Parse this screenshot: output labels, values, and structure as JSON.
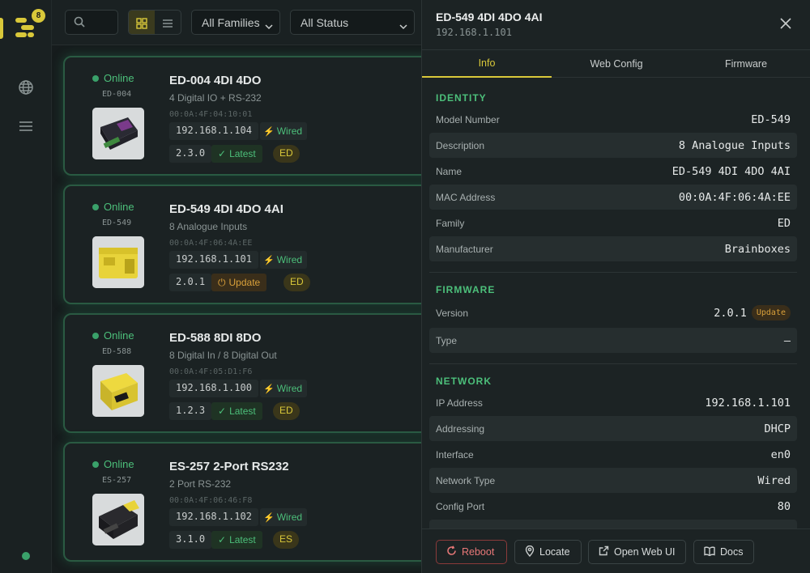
{
  "rail": {
    "badge": "8"
  },
  "toolbar": {
    "search_placeholder": "",
    "family_filter": "All Families",
    "status_filter": "All Status"
  },
  "devices": [
    {
      "status": "Online",
      "model": "ED-004",
      "title": "ED-004 4DI 4DO",
      "desc": "4 Digital IO + RS-232",
      "mac": "00:0A:4F:04:10:01",
      "ip": "192.168.1.104",
      "net": "Wired",
      "version": "2.3.0",
      "fw": "Latest",
      "family": "ED"
    },
    {
      "status": "Online",
      "model": "ED-549",
      "title": "ED-549 4DI 4DO 4AI",
      "desc": "8 Analogue Inputs",
      "mac": "00:0A:4F:06:4A:EE",
      "ip": "192.168.1.101",
      "net": "Wired",
      "version": "2.0.1",
      "fw": "Update",
      "family": "ED"
    },
    {
      "status": "Online",
      "model": "ED-588",
      "title": "ED-588 8DI 8DO",
      "desc": "8 Digital In / 8 Digital Out",
      "mac": "00:0A:4F:05:D1:F6",
      "ip": "192.168.1.100",
      "net": "Wired",
      "version": "1.2.3",
      "fw": "Latest",
      "family": "ED"
    },
    {
      "status": "Online",
      "model": "ES-257",
      "title": "ES-257 2-Port RS232",
      "desc": "2 Port RS-232",
      "mac": "00:0A:4F:06:46:F8",
      "ip": "192.168.1.102",
      "net": "Wired",
      "version": "3.1.0",
      "fw": "Latest",
      "family": "ES"
    }
  ],
  "drawer": {
    "title": "ED-549 4DI 4DO 4AI",
    "subtitle": "192.168.1.101",
    "tabs": [
      "Info",
      "Web Config",
      "Firmware"
    ],
    "identity": {
      "heading": "IDENTITY",
      "rows": [
        {
          "k": "Model Number",
          "v": "ED-549"
        },
        {
          "k": "Description",
          "v": "8 Analogue Inputs"
        },
        {
          "k": "Name",
          "v": "ED-549 4DI 4DO 4AI"
        },
        {
          "k": "MAC Address",
          "v": "00:0A:4F:06:4A:EE"
        },
        {
          "k": "Family",
          "v": "ED"
        },
        {
          "k": "Manufacturer",
          "v": "Brainboxes"
        }
      ]
    },
    "firmware": {
      "heading": "FIRMWARE",
      "version_label": "Version",
      "version": "2.0.1",
      "update_badge": "Update",
      "type_label": "Type",
      "type": "—"
    },
    "network": {
      "heading": "NETWORK",
      "rows": [
        {
          "k": "IP Address",
          "v": "192.168.1.101"
        },
        {
          "k": "Addressing",
          "v": "DHCP"
        },
        {
          "k": "Interface",
          "v": "en0"
        },
        {
          "k": "Network Type",
          "v": "Wired"
        },
        {
          "k": "Config Port",
          "v": "80"
        }
      ]
    },
    "actions": {
      "reboot": "Reboot",
      "locate": "Locate",
      "webui": "Open Web UI",
      "docs": "Docs"
    }
  },
  "colors": {
    "accent": "#d9c83a",
    "online": "#4cbf7a",
    "update": "#d9a03a",
    "danger": "#e87878"
  }
}
